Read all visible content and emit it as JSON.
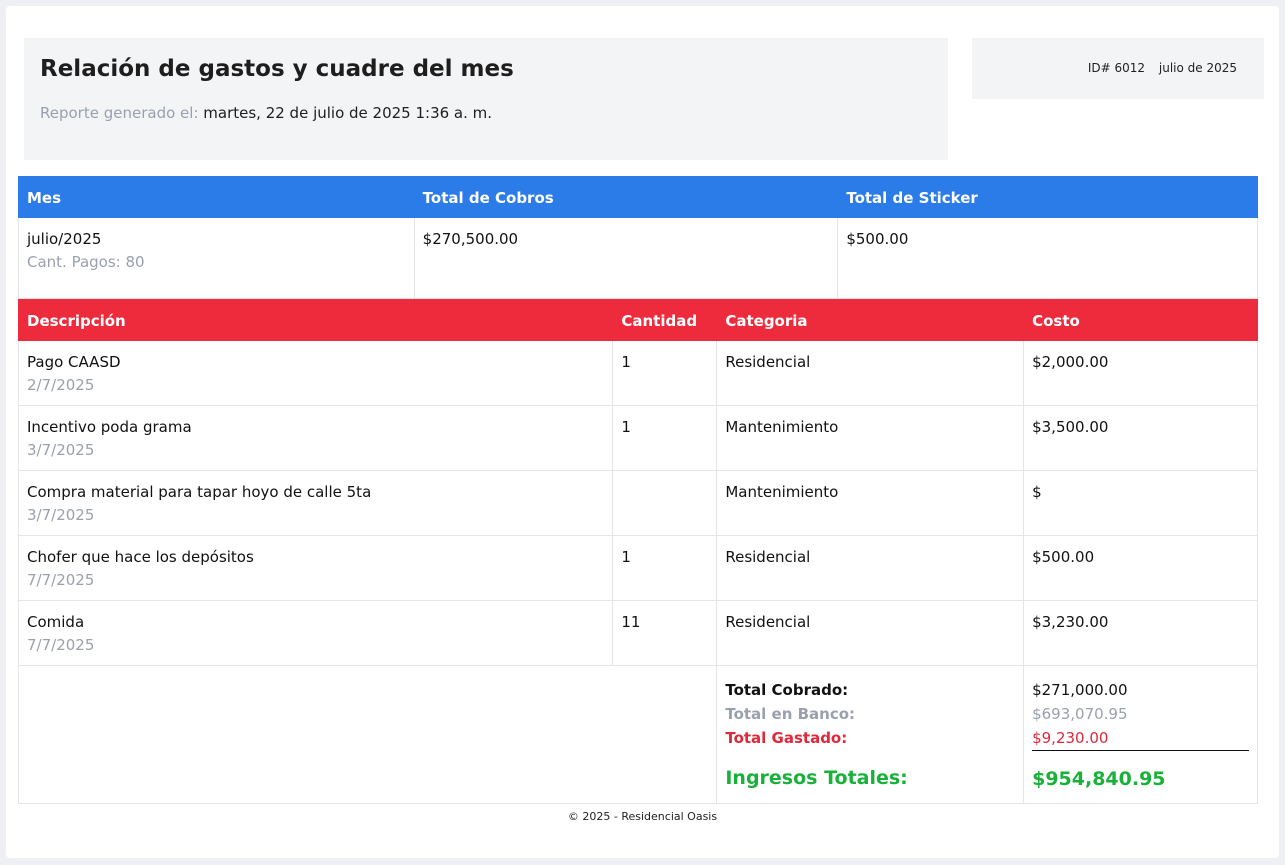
{
  "header": {
    "title": "Relación de gastos y cuadre del mes",
    "generated_label": "Reporte generado el:",
    "generated_value": "martes, 22 de julio de 2025 1:36 a. m.",
    "id": "ID# 6012",
    "period": "julio de 2025"
  },
  "summary": {
    "headers": [
      "Mes",
      "Total de Cobros",
      "Total de Sticker"
    ],
    "month": "julio/2025",
    "payments_count": "Cant. Pagos: 80",
    "total_cobros": "$270,500.00",
    "total_sticker": "$500.00"
  },
  "expenses": {
    "headers": [
      "Descripción",
      "Cantidad",
      "Categoria",
      "Costo"
    ],
    "rows": [
      {
        "description": "Pago CAASD",
        "date": "2/7/2025",
        "qty": "1",
        "category": "Residencial",
        "cost": "$2,000.00"
      },
      {
        "description": "Incentivo poda grama",
        "date": "3/7/2025",
        "qty": "1",
        "category": "Mantenimiento",
        "cost": "$3,500.00"
      },
      {
        "description": "Compra material para tapar hoyo de calle 5ta",
        "date": "3/7/2025",
        "qty": "",
        "category": "Mantenimiento",
        "cost": "$"
      },
      {
        "description": "Chofer que hace los depósitos",
        "date": "7/7/2025",
        "qty": "1",
        "category": "Residencial",
        "cost": "$500.00"
      },
      {
        "description": "Comida",
        "date": "7/7/2025",
        "qty": "11",
        "category": "Residencial",
        "cost": "$3,230.00"
      }
    ]
  },
  "totals": {
    "cobrado_label": "Total Cobrado:",
    "cobrado_value": "$271,000.00",
    "banco_label": "Total en Banco:",
    "banco_value": "$693,070.95",
    "gastado_label": "Total Gastado:",
    "gastado_value": "$9,230.00",
    "ingresos_label": "Ingresos Totales:",
    "ingresos_value": "$954,840.95"
  },
  "footer": "© 2025 - Residencial Oasis",
  "colors": {
    "summary_header": "#2b7ce9",
    "expenses_header": "#ee2b3d",
    "ingresos": "#19b13a"
  }
}
